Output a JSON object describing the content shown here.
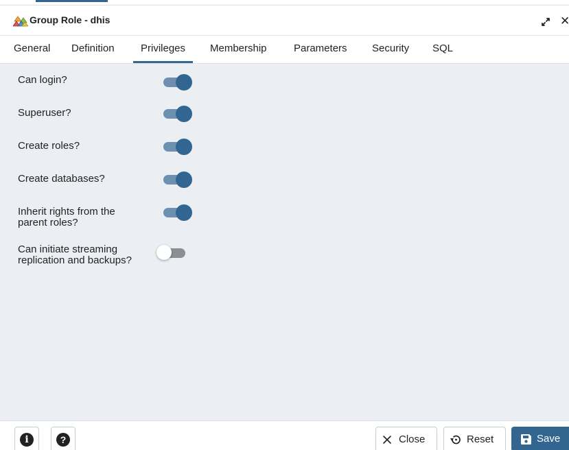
{
  "dialog": {
    "title": "Group Role - dhis",
    "title_icon": "group-role-icon",
    "expand_icon": "expand-icon",
    "close_glyph": "✕"
  },
  "tabs": [
    {
      "label": "General",
      "active": false
    },
    {
      "label": "Definition",
      "active": false
    },
    {
      "label": "Privileges",
      "active": true
    },
    {
      "label": "Membership",
      "active": false
    },
    {
      "label": "Parameters",
      "active": false
    },
    {
      "label": "Security",
      "active": false
    },
    {
      "label": "SQL",
      "active": false
    }
  ],
  "privileges": [
    {
      "label": "Can login?",
      "enabled": true
    },
    {
      "label": "Superuser?",
      "enabled": true
    },
    {
      "label": "Create roles?",
      "enabled": true
    },
    {
      "label": "Create databases?",
      "enabled": true
    },
    {
      "label": "Inherit rights from the parent roles?",
      "enabled": true
    },
    {
      "label": "Can initiate streaming replication and backups?",
      "enabled": false
    }
  ],
  "footer": {
    "info_glyph": "i",
    "help_glyph": "?",
    "close_label": "Close",
    "reset_label": "Reset",
    "save_label": "Save"
  },
  "colors": {
    "accent": "#326690",
    "toggle_track_on": "#6f8fb1",
    "content_bg": "#ebeef3"
  }
}
